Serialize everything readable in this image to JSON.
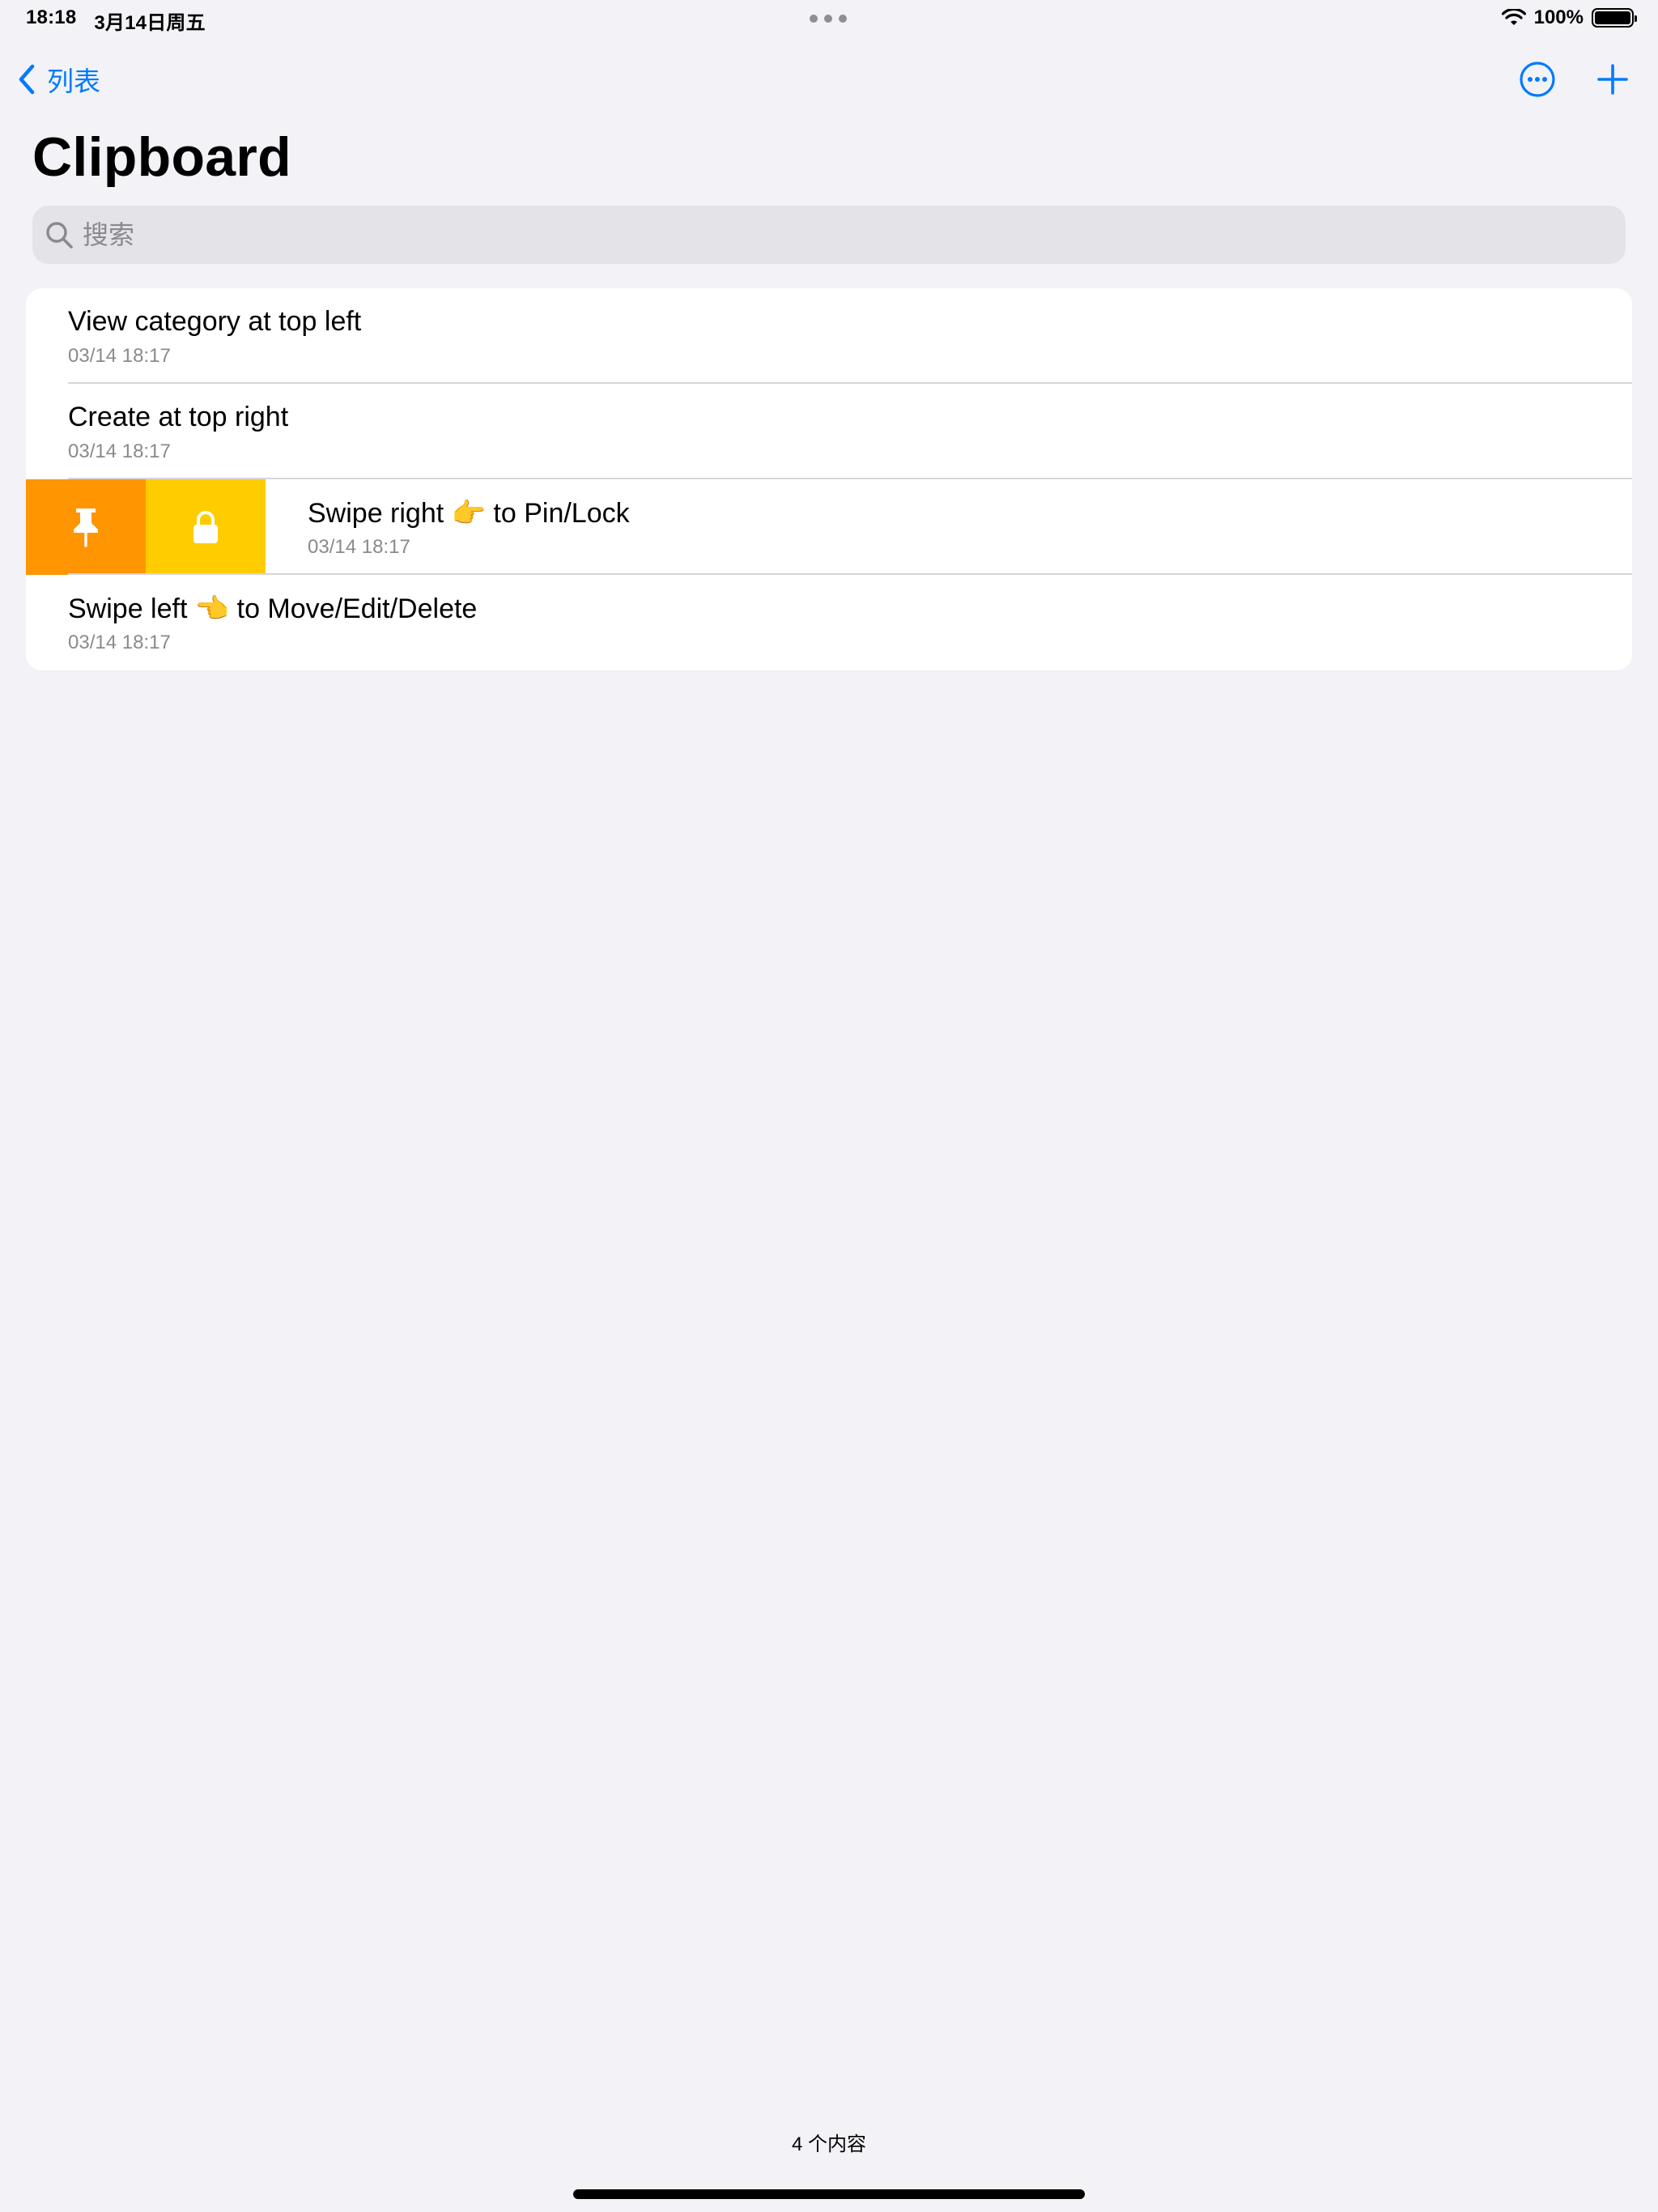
{
  "status_bar": {
    "time": "18:18",
    "date": "3月14日周五",
    "battery": "100%",
    "battery_level": 1.0
  },
  "nav": {
    "back_label": "列表",
    "more_icon": "ellipsis-circle-icon",
    "add_icon": "plus-icon"
  },
  "page": {
    "title": "Clipboard"
  },
  "search": {
    "placeholder": "搜索",
    "value": ""
  },
  "items": [
    {
      "title": "View category at top left",
      "date": "03/14 18:17"
    },
    {
      "title": "Create at top right",
      "date": "03/14 18:17"
    },
    {
      "title": "Swipe right 👉 to Pin/Lock",
      "date": "03/14 18:17"
    },
    {
      "title": "Swipe left 👈 to Move/Edit/Delete",
      "date": "03/14 18:17"
    }
  ],
  "swipe_actions": {
    "pin": {
      "icon": "pin-icon",
      "color": "#FF9500"
    },
    "lock": {
      "icon": "lock-icon",
      "color": "#FFCC00"
    }
  },
  "footer": {
    "count_text": "4 个内容"
  },
  "colors": {
    "accent": "#007AFF",
    "background": "#F2F2F7"
  }
}
